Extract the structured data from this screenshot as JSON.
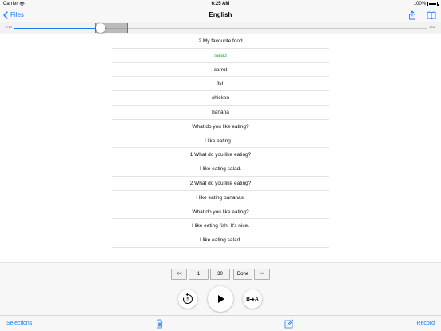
{
  "status_bar": {
    "carrier": "Carrier",
    "time": "6:25 AM",
    "battery_percent": "100%"
  },
  "nav": {
    "back_label": "Files",
    "title": "English",
    "icons": [
      "share-icon",
      "book-icon"
    ]
  },
  "player": {
    "current_time": "0:13",
    "total_time": "1:02",
    "progress_fraction": 0.21
  },
  "sentences": [
    "2 My favourite food",
    "salad",
    "carrot",
    "fish",
    "chicken",
    "banana",
    "What do you like eating?",
    "I like eating ...",
    "1 What do you like eating?",
    "I like eating salad.",
    "2 What do you like eating?",
    "I like eating bananas.",
    "What do you like eating?",
    "I like eating fish. It's nice.",
    "I like eating salad."
  ],
  "active_index": 1,
  "range_controls": {
    "prev": "<<",
    "start": "1",
    "end": "30",
    "done": "Done",
    "more": "•••"
  },
  "transport": {
    "ab_from": "B",
    "ab_to": "A",
    "icons": [
      "replay-5-icon",
      "play-icon",
      "ab-repeat-icon"
    ]
  },
  "toolbar": {
    "selections": "Selections",
    "record": "Record",
    "icons": [
      "trash-icon",
      "edit-icon"
    ]
  },
  "colors": {
    "accent": "#1a7cf5",
    "active_text": "#2cb33c",
    "marker_start": "#2cb33c",
    "marker_end": "#e04040"
  }
}
